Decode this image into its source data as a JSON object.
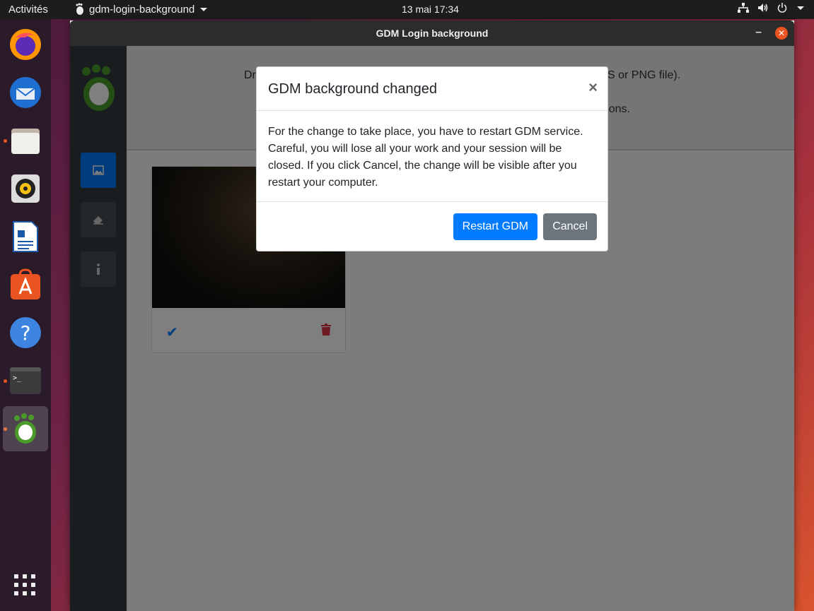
{
  "topbar": {
    "activities": "Activités",
    "app_name": "gdm-login-background",
    "clock": "13 mai  17:34"
  },
  "window": {
    "title": "GDM Login background"
  },
  "content": {
    "drop_text_start": "Dr",
    "drop_text_end": "S or PNG file).",
    "drop_text_line2": "ions."
  },
  "modal": {
    "title": "GDM background changed",
    "close_symbol": "×",
    "body": "For the change to take place, you have to restart GDM service. Careful, you will lose all your work and your session will be closed. If you click Cancel, the change will be visible after you restart your computer.",
    "restart_label": "Restart GDM",
    "cancel_label": "Cancel"
  },
  "dock": {
    "items": [
      "firefox-icon",
      "thunderbird-icon",
      "files-icon",
      "rhythmbox-icon",
      "libreoffice-writer-icon",
      "ubuntu-software-icon",
      "help-icon",
      "terminal-icon",
      "gdm-login-background-icon"
    ]
  },
  "colors": {
    "primary": "#007bff",
    "secondary": "#6c757d",
    "danger": "#dc3545",
    "ubuntu_orange": "#e95420"
  }
}
